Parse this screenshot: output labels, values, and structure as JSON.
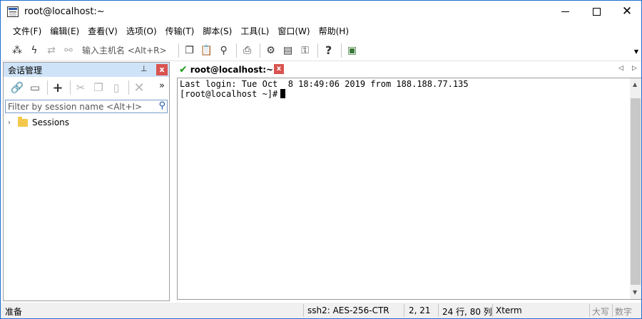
{
  "window": {
    "title": "root@localhost:~",
    "minimize_glyph": "",
    "maximize_glyph": "",
    "close_glyph": "✕"
  },
  "menu": {
    "items": [
      "文件(F)",
      "编辑(E)",
      "查看(V)",
      "选项(O)",
      "传输(T)",
      "脚本(S)",
      "工具(L)",
      "窗口(W)",
      "帮助(H)"
    ]
  },
  "toolbar": {
    "quick_connect_placeholder": "输入主机名 <Alt+R>"
  },
  "session_manager": {
    "title": "会话管理",
    "close_glyph": "x",
    "pin_glyph": "📌",
    "more_glyph": "»",
    "filter_placeholder": "Filter by session name <Alt+I>",
    "tree": [
      {
        "label": "Sessions",
        "expand_glyph": "›"
      }
    ]
  },
  "tabs": [
    {
      "label": "root@localhost:~",
      "active": true,
      "status": "connected",
      "close_glyph": "x"
    }
  ],
  "terminal": {
    "lines": [
      "Last login: Tue Oct  8 18:49:06 2019 from 188.188.77.135",
      "[root@localhost ~]#"
    ]
  },
  "statusbar": {
    "ready": "准备",
    "encryption": "ssh2: AES-256-CTR",
    "cursor_pos": "2,  21",
    "size": "24 行, 80 列",
    "term_type": "Xterm",
    "caps": "大写",
    "num": "数字"
  },
  "colors": {
    "accent": "#1e6fd1",
    "panel_header": "#cfe3f8",
    "close_red": "#d9534f",
    "connected_green": "#1a9a1a"
  }
}
